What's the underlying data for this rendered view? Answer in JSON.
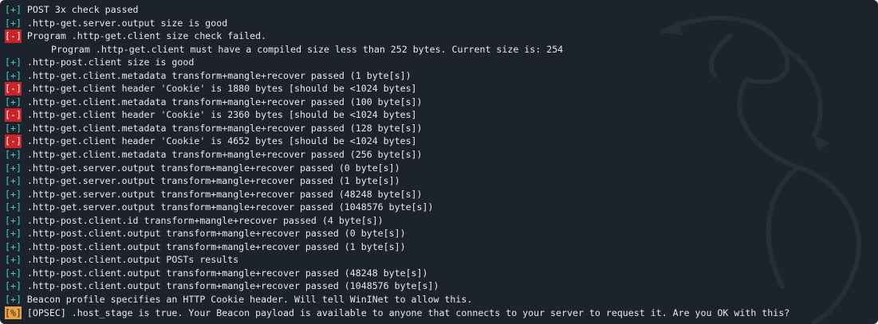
{
  "colors": {
    "background": "#1d232c",
    "text": "#e7e9ec",
    "plus_tag": "#39d0c4",
    "minus_tag_bg": "#c8242a",
    "percent_tag_bg": "#e7a23b"
  },
  "decoration": "dragon-watermark-icon",
  "lines": [
    {
      "tag": "[+]",
      "type": "plus",
      "text": " POST 3x check passed"
    },
    {
      "tag": "[+]",
      "type": "plus",
      "text": " .http-get.server.output size is good"
    },
    {
      "tag": "[-]",
      "type": "minus",
      "text": " Program .http-get.client size check failed."
    },
    {
      "tag": "",
      "type": "indent",
      "text": "Program .http-get.client must have a compiled size less than 252 bytes. Current size is: 254"
    },
    {
      "tag": "[+]",
      "type": "plus",
      "text": " .http-post.client size is good"
    },
    {
      "tag": "[+]",
      "type": "plus",
      "text": " .http-get.client.metadata transform+mangle+recover passed (1 byte[s])"
    },
    {
      "tag": "[-]",
      "type": "minus",
      "text": " .http-get.client header 'Cookie' is 1880 bytes [should be <1024 bytes]"
    },
    {
      "tag": "[+]",
      "type": "plus",
      "text": " .http-get.client.metadata transform+mangle+recover passed (100 byte[s])"
    },
    {
      "tag": "[-]",
      "type": "minus",
      "text": " .http-get.client header 'Cookie' is 2360 bytes [should be <1024 bytes]"
    },
    {
      "tag": "[+]",
      "type": "plus",
      "text": " .http-get.client.metadata transform+mangle+recover passed (128 byte[s])"
    },
    {
      "tag": "[-]",
      "type": "minus",
      "text": " .http-get.client header 'Cookie' is 4652 bytes [should be <1024 bytes]"
    },
    {
      "tag": "[+]",
      "type": "plus",
      "text": " .http-get.client.metadata transform+mangle+recover passed (256 byte[s])"
    },
    {
      "tag": "[+]",
      "type": "plus",
      "text": " .http-get.server.output transform+mangle+recover passed (0 byte[s])"
    },
    {
      "tag": "[+]",
      "type": "plus",
      "text": " .http-get.server.output transform+mangle+recover passed (1 byte[s])"
    },
    {
      "tag": "[+]",
      "type": "plus",
      "text": " .http-get.server.output transform+mangle+recover passed (48248 byte[s])"
    },
    {
      "tag": "[+]",
      "type": "plus",
      "text": " .http-get.server.output transform+mangle+recover passed (1048576 byte[s])"
    },
    {
      "tag": "[+]",
      "type": "plus",
      "text": " .http-post.client.id transform+mangle+recover passed (4 byte[s])"
    },
    {
      "tag": "[+]",
      "type": "plus",
      "text": " .http-post.client.output transform+mangle+recover passed (0 byte[s])"
    },
    {
      "tag": "[+]",
      "type": "plus",
      "text": " .http-post.client.output transform+mangle+recover passed (1 byte[s])"
    },
    {
      "tag": "[+]",
      "type": "plus",
      "text": " .http-post.client.output POSTs results"
    },
    {
      "tag": "[+]",
      "type": "plus",
      "text": " .http-post.client.output transform+mangle+recover passed (48248 byte[s])"
    },
    {
      "tag": "[+]",
      "type": "plus",
      "text": " .http-post.client.output transform+mangle+recover passed (1048576 byte[s])"
    },
    {
      "tag": "[+]",
      "type": "plus",
      "text": " Beacon profile specifies an HTTP Cookie header. Will tell WinINet to allow this."
    },
    {
      "tag": "[%]",
      "type": "pct",
      "text": " [OPSEC] .host_stage is true. Your Beacon payload is available to anyone that connects to your server to request it. Are you OK with this?"
    }
  ]
}
